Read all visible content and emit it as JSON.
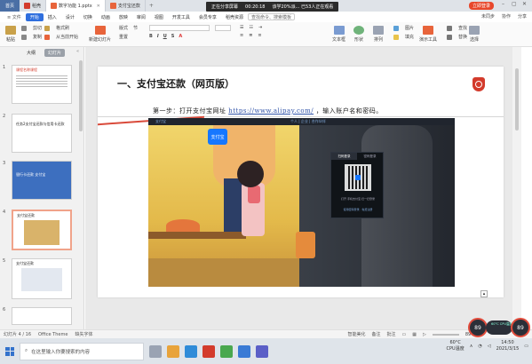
{
  "tabs": {
    "home": "首页",
    "items": [
      {
        "label": "稻壳",
        "color": "#d33b2c"
      },
      {
        "label": "数字功能 1.pptx",
        "color": "#e8643b"
      },
      {
        "label": "支付宝还款",
        "color": "#e8643b"
      }
    ],
    "share_banner": {
      "status": "正在分享屏幕",
      "time": "00:20:18",
      "notice": "该学20%派...  已53人正在观看"
    },
    "login": "立即登录"
  },
  "menu": {
    "items": [
      "开始",
      "插入",
      "设计",
      "切换",
      "动画",
      "放映",
      "审阅",
      "视图",
      "开发工具",
      "会员专享",
      "稻壳资源"
    ],
    "active_index": 0,
    "search": "查找命令、搜索模板",
    "right": [
      "未同步",
      "协作",
      "分享"
    ]
  },
  "toolbar": {
    "paste": "粘贴",
    "cut": "剪切",
    "copy": "复制",
    "format_painter": "格式刷",
    "from_current": "从当前开始",
    "new_slide": "新建幻灯片",
    "layout": "版式",
    "section": "节",
    "reset": "重置",
    "text_box": "文本框",
    "shape": "形状",
    "arrange": "排列",
    "picture": "图片",
    "fill": "填充",
    "outline": "轮廓",
    "present": "演示工具",
    "replace": "替换",
    "select": "选择",
    "find": "查找"
  },
  "left_panel": {
    "tabs": [
      "大纲",
      "幻灯片"
    ],
    "active_tab": 1,
    "thumbnails": [
      {
        "num": "1",
        "title": "课程名称课程"
      },
      {
        "num": "2",
        "title": "任务2支付宝还款与信用卡还款"
      },
      {
        "num": "3",
        "title": "银行卡还款 支付宝"
      },
      {
        "num": "4",
        "title": "支付宝还款"
      },
      {
        "num": "5",
        "title": "支付宝还款"
      },
      {
        "num": "6",
        "title": ""
      }
    ],
    "selected": 3,
    "add_slide": "+"
  },
  "slide": {
    "heading": "一、支付宝还款（网页版）",
    "step_prefix": "第一步：打开支付宝网址",
    "step_url": "https://www.alipay.com/",
    "step_suffix": "，输入账户名和密码。",
    "alipay": {
      "topbar_left": "支付宝",
      "topbar_right": "个人 | 企业 | 合作伙伴",
      "logo": "支付宝",
      "qr_tabs": [
        "扫码登录",
        "密码登录"
      ],
      "qr_caption": "打开 手机支付宝 扫一扫登录",
      "qr_links": "使用密码登录 · 免费注册"
    }
  },
  "status": {
    "slide_info": "幻灯片 4 / 16",
    "theme": "Office Theme",
    "font_missing": "缺失字体",
    "smart_beautify": "智能美化",
    "notes": "备注",
    "comments": "批注",
    "zoom": "89%"
  },
  "taskbar": {
    "search_placeholder": "在这里输入你要搜索的内容",
    "temp": "60°C",
    "temp_label": "CPU温度",
    "time": "14:50",
    "date": "2021/3/15"
  },
  "perf": {
    "left": "89",
    "pill": "60°C CPU温度",
    "right": "89"
  },
  "colors": {
    "accent_blue": "#2f6fde",
    "brand_red": "#d33b2c",
    "alipay_blue": "#1677ff"
  }
}
